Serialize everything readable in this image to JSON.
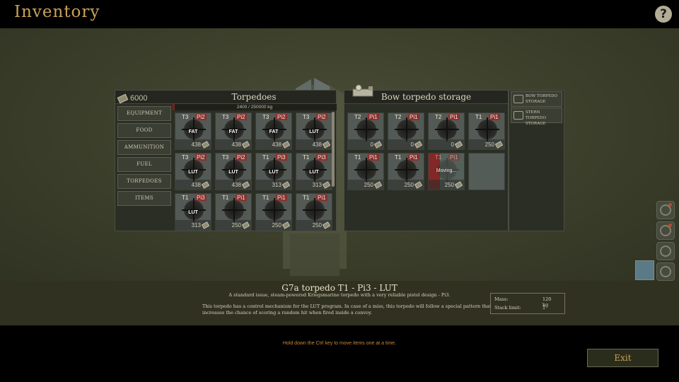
{
  "header": {
    "title": "Inventory",
    "help_label": "?"
  },
  "left_panel": {
    "money": "6000",
    "title": "Torpedoes",
    "capacity": "2400 / 250000 kg",
    "categories": [
      "EQUIPMENT",
      "FOOD",
      "AMMUNITION",
      "FUEL",
      "TORPEDOES",
      "ITEMS"
    ],
    "slots": [
      {
        "t": "T3",
        "p": "Pi2",
        "prog": "FAT",
        "price": "438"
      },
      {
        "t": "T3",
        "p": "Pi2",
        "prog": "FAT",
        "price": "438"
      },
      {
        "t": "T3",
        "p": "Pi2",
        "prog": "FAT",
        "price": "438"
      },
      {
        "t": "T3",
        "p": "Pi2",
        "prog": "LUT",
        "price": "438"
      },
      {
        "t": "T3",
        "p": "Pi2",
        "prog": "LUT",
        "price": "438"
      },
      {
        "t": "T3",
        "p": "Pi2",
        "prog": "LUT",
        "price": "438"
      },
      {
        "t": "T1",
        "p": "Pi3",
        "prog": "LUT",
        "price": "313"
      },
      {
        "t": "T1",
        "p": "Pi3",
        "prog": "LUT",
        "price": "313"
      },
      {
        "t": "T1",
        "p": "Pi3",
        "prog": "LUT",
        "price": "313"
      },
      {
        "t": "T1",
        "p": "Pi1",
        "prog": "",
        "price": "250"
      },
      {
        "t": "T1",
        "p": "Pi1",
        "prog": "",
        "price": "250"
      },
      {
        "t": "T1",
        "p": "Pi1",
        "prog": "",
        "price": "250"
      }
    ]
  },
  "right_panel": {
    "title": "Bow torpedo storage",
    "slots": [
      {
        "t": "T2",
        "p": "Pi1",
        "price": "0"
      },
      {
        "t": "T2",
        "p": "Pi1",
        "price": "0"
      },
      {
        "t": "T2",
        "p": "Pi1",
        "price": "0"
      },
      {
        "t": "T1",
        "p": "Pi1",
        "price": "250"
      },
      {
        "t": "T1",
        "p": "Pi1",
        "price": "250"
      },
      {
        "t": "T1",
        "p": "Pi1",
        "price": "250"
      },
      {
        "t": "T1",
        "p": "Pi1",
        "price": "250",
        "moving": "Moving..."
      }
    ]
  },
  "storages": [
    "BOW TORPEDO STORAGE",
    "STERN TORPEDO STORAGE"
  ],
  "details": {
    "name": "G7a torpedo T1 - Pi3 - LUT",
    "desc1": "A standard issue, steam-powered Kriegsmarine torpedo with a very reliable pistol design - Pi3.",
    "desc2": "This torpedo has a control mechanism for the LUT program. In case of a miss, this torpedo will follow a special pattern that increases the chance of scoring a random hit when fired inside a convoy.",
    "mass_label": "Mass:",
    "mass_value": "120 kg",
    "stack_label": "Stack limit:",
    "stack_value": "1"
  },
  "footer": {
    "hint": "Hold down the Ctrl key to move items one at a time.",
    "exit_label": "Exit"
  },
  "colors": {
    "accent": "#c9a25a",
    "hint": "#c9883a",
    "pistol_tag": "#8a3030"
  }
}
